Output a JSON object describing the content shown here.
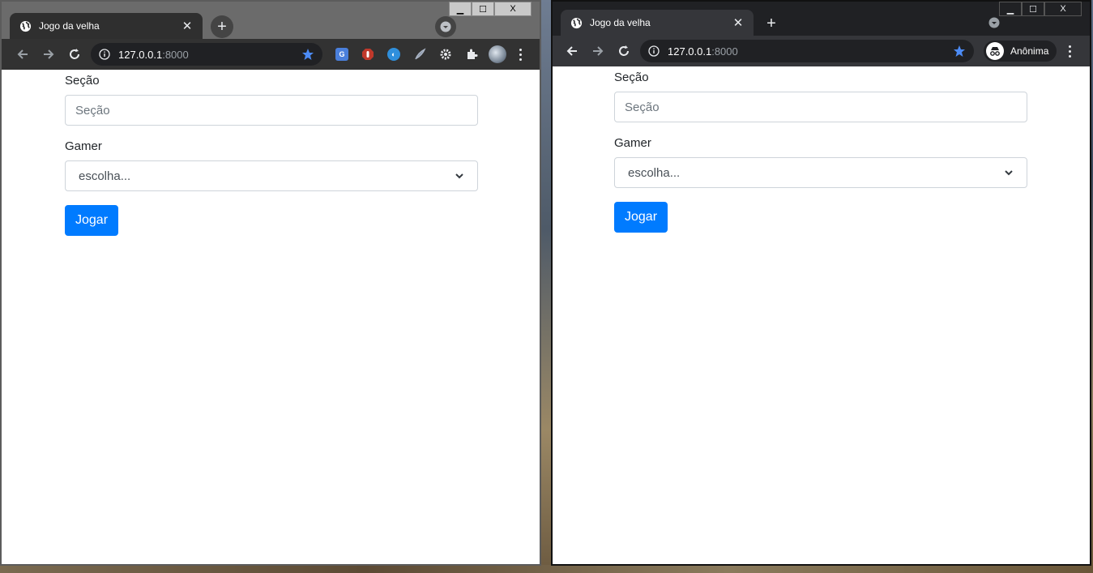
{
  "windows": [
    {
      "tab": {
        "title": "Jogo da velha"
      },
      "address": {
        "host": "127.0.0.1",
        "port": ":8000"
      },
      "window_controls": {
        "close": "X"
      },
      "form": {
        "secao_label": "Seção",
        "secao_placeholder": "Seção",
        "gamer_label": "Gamer",
        "gamer_selected": "escolha...",
        "submit_label": "Jogar"
      }
    },
    {
      "tab": {
        "title": "Jogo da velha"
      },
      "address": {
        "host": "127.0.0.1",
        "port": ":8000"
      },
      "window_controls": {
        "close": "X"
      },
      "profile": {
        "label": "Anônima"
      },
      "form": {
        "secao_label": "Seção",
        "secao_placeholder": "Seção",
        "gamer_label": "Gamer",
        "gamer_selected": "escolha...",
        "submit_label": "Jogar"
      }
    }
  ],
  "colors": {
    "primary_button": "#007bff",
    "bookmark_star": "#4c8bf5",
    "incognito_chrome": "#202124"
  },
  "icons": [
    "globe-icon",
    "close-icon",
    "plus-icon",
    "tab-search-icon",
    "back-arrow-icon",
    "forward-arrow-icon",
    "reload-icon",
    "info-icon",
    "star-icon",
    "puzzle-icon",
    "gear-icon",
    "incognito-icon",
    "menu-dots-icon",
    "chevron-down-icon"
  ]
}
